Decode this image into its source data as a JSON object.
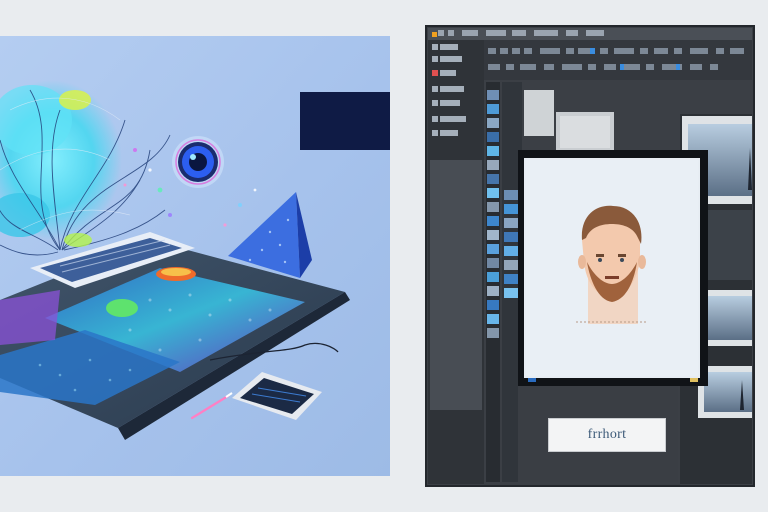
{
  "editor": {
    "export_button_label": "frrhort"
  },
  "colors": {
    "page_background": "#e9ecef",
    "art_panel_background": "#a9c7ee",
    "editor_chrome": "#3b3f45",
    "editor_panel": "#2f3338",
    "canvas_paper": "#e7edf3",
    "accent_cyan": "#38d3ee",
    "accent_blue": "#2e7fd8"
  },
  "icons": [
    "tool-icon",
    "layer-thumbnail-icon",
    "sparkle-icon",
    "color-picker-icon"
  ]
}
